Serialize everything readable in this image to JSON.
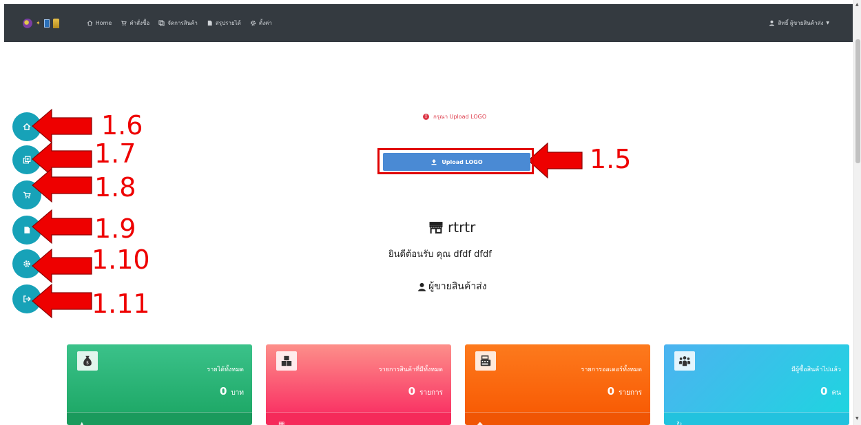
{
  "colors": {
    "navbar": "#343a40",
    "side_button": "#17a2b8",
    "upload_button": "#4a8ad4",
    "annotation": "#ee0000",
    "alert": "#dc3545"
  },
  "nav": {
    "links": [
      {
        "icon": "home-icon",
        "label": "Home"
      },
      {
        "icon": "cart-icon",
        "label": "คำสั่งซื้อ"
      },
      {
        "icon": "product-icon",
        "label": "จัดการสินค้า"
      },
      {
        "icon": "report-icon",
        "label": "สรุปรายได้"
      },
      {
        "icon": "gear-icon",
        "label": "ตั้งค่า"
      }
    ],
    "user_label": "สิทธิ์ ผู้ขายสินค้าส่ง"
  },
  "annotations": [
    "1.5",
    "1.6",
    "1.7",
    "1.8",
    "1.9",
    "1.10",
    "1.11"
  ],
  "main": {
    "alert_text": "กรุณา Upload LOGO",
    "upload_label": "Upload LOGO",
    "shop_name": "rtrtr",
    "welcome_text": "ยินดีต้อนรับ คุณ dfdf dfdf",
    "role_text": "ผู้ขายสินค้าส่ง"
  },
  "cards": [
    {
      "title": "รายได้ทั้งหมด",
      "value": "0",
      "unit": "บาท",
      "icon": "money-bag-icon",
      "color": "#2fb37a"
    },
    {
      "title": "รายการสินค้าที่มีทั้งหมด",
      "value": "0",
      "unit": "รายการ",
      "icon": "boxes-icon",
      "color": "#f94d70"
    },
    {
      "title": "รายการออเดอร์ทั้งหมด",
      "value": "0",
      "unit": "รายการ",
      "icon": "cash-register-icon",
      "color": "#fb6a12"
    },
    {
      "title": "มีผู้ซื้อสินค้าไปแล้ว",
      "value": "0",
      "unit": "คน",
      "icon": "users-icon",
      "color": "#2cc6e4"
    }
  ]
}
